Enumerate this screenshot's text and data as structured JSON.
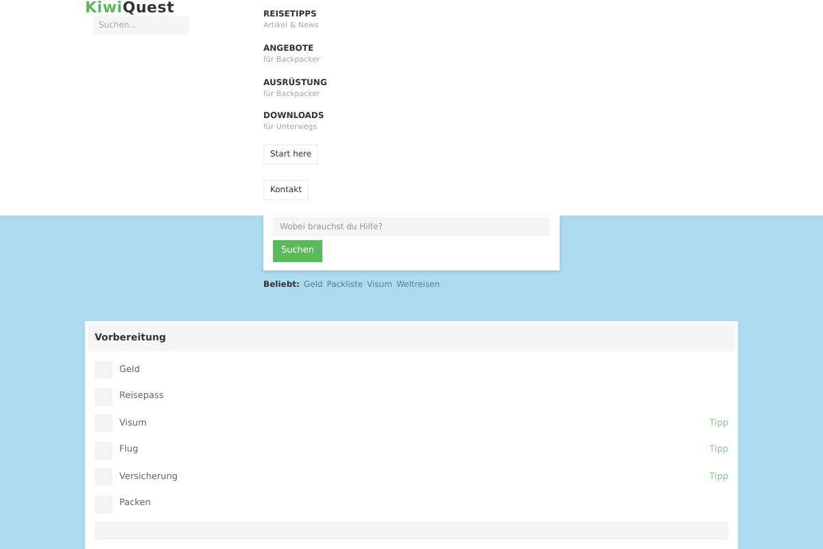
{
  "logo": {
    "part1": "Kiwi",
    "part2": "Quest"
  },
  "search": {
    "placeholder": "Suchen..."
  },
  "nav": [
    {
      "title": "REISETIPPS",
      "subtitle": "Artikel & News"
    },
    {
      "title": "ANGEBOTE",
      "subtitle": "für Backpacker"
    },
    {
      "title": "AUSRÜSTUNG",
      "subtitle": "für Backpacker"
    },
    {
      "title": "DOWNLOADS",
      "subtitle": "für Unterwegs"
    }
  ],
  "nav_buttons": [
    "Start here",
    "Kontakt"
  ],
  "help": {
    "placeholder": "Wobei brauchst du Hilfe?",
    "button": "Suchen"
  },
  "popular": {
    "label": "Beliebt:",
    "links": [
      "Geld",
      "Packliste",
      "Visum",
      "Weltreisen"
    ]
  },
  "checklist": {
    "title": "Vorbereitung",
    "items": [
      {
        "label": "Geld",
        "checked": false
      },
      {
        "label": "Reisepass",
        "checked": false
      },
      {
        "label": "Visum",
        "checked": false,
        "tip": "Tipp"
      },
      {
        "label": "Flug",
        "checked": false,
        "tip": "Tipp"
      },
      {
        "label": "Versicherung",
        "checked": false,
        "tip": "Tipp"
      },
      {
        "label": "Packen",
        "checked": false
      }
    ]
  }
}
